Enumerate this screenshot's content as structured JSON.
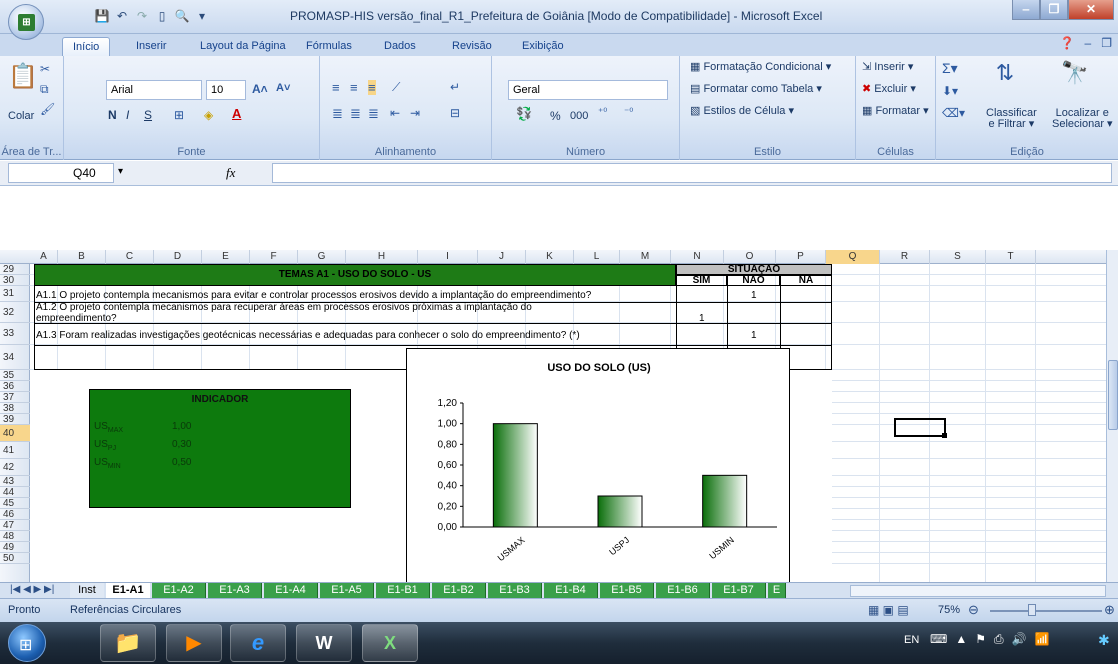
{
  "window": {
    "title": "PROMASP-HIS versão_final_R1_Prefeitura de Goiânia [Modo de Compatibilidade] - Microsoft Excel"
  },
  "ribbon_tabs": [
    "Início",
    "Inserir",
    "Layout da Página",
    "Fórmulas",
    "Dados",
    "Revisão",
    "Exibição"
  ],
  "ribbon": {
    "paste": "Colar",
    "clipboard_label": "Área de Tr...",
    "font_name": "Arial",
    "font_size": "10",
    "bold": "N",
    "italic": "I",
    "underline": "S",
    "font_label": "Fonte",
    "alignment_label": "Alinhamento",
    "number_format": "Geral",
    "percent": "%",
    "thousands": "000",
    "number_label": "Número",
    "cond_format": "Formatação Condicional",
    "format_table": "Formatar como Tabela",
    "cell_styles": "Estilos de Célula",
    "style_label": "Estilo",
    "insert": "Inserir",
    "delete": "Excluir",
    "format": "Formatar",
    "cells_label": "Células",
    "sort_filter_1": "Classificar",
    "sort_filter_2": "e Filtrar",
    "find_select_1": "Localizar e",
    "find_select_2": "Selecionar",
    "editing_label": "Edição"
  },
  "formula_bar": {
    "name_box": "Q40",
    "fx": "fx",
    "formula": ""
  },
  "columns": [
    "A",
    "B",
    "C",
    "D",
    "E",
    "F",
    "G",
    "H",
    "I",
    "J",
    "K",
    "L",
    "M",
    "N",
    "O",
    "P",
    "Q",
    "R",
    "S",
    "T"
  ],
  "rows": [
    "29",
    "30",
    "31",
    "32",
    "33",
    "34",
    "35",
    "36",
    "37",
    "38",
    "39",
    "40",
    "41",
    "42",
    "43",
    "44",
    "45",
    "46",
    "47",
    "48",
    "49",
    "50"
  ],
  "table": {
    "title": "TEMAS A1 - USO DO SOLO - US",
    "situacao": "SITUAÇÃO",
    "sim": "SIM",
    "nao": "NÃO",
    "na": "NA",
    "q1": "A1.1 O projeto contempla mecanismos para evitar e controlar processos erosivos devido a implantação do empreendimento?",
    "q1_nao": "1",
    "q2a": "A1.2 O projeto contempla mecanismos para recuperar áreas em processos erosivos próximas a implantação do",
    "q2b": "empreendimento?",
    "q2_sim": "1",
    "q3": "A1.3 Foram realizadas investigações geotécnicas necessárias e adequadas  para conhecer o solo do empreendimento? (*)",
    "q3_nao": "1"
  },
  "indicator": {
    "title": "INDICADOR",
    "us": "US",
    "max_sub": "MAX",
    "pj_sub": "PJ",
    "min_sub": "MIN",
    "max_val": "1,00",
    "pj_val": "0,30",
    "min_val": "0,50"
  },
  "chart_data": {
    "type": "bar",
    "title": "USO DO SOLO (US)",
    "categories": [
      "USMAX",
      "USPJ",
      "USMIN"
    ],
    "values": [
      1.0,
      0.3,
      0.5
    ],
    "ylim": [
      0,
      1.2
    ],
    "yticks": [
      "0,00",
      "0,20",
      "0,40",
      "0,60",
      "0,80",
      "1,00",
      "1,20"
    ],
    "xlabel": "",
    "ylabel": "",
    "grid": false,
    "bar_fill": "green gradient"
  },
  "sheet_tabs": [
    "Inst",
    "E1-A1",
    "E1-A2",
    "E1-A3",
    "E1-A4",
    "E1-A5",
    "E1-B1",
    "E1-B2",
    "E1-B3",
    "E1-B4",
    "E1-B5",
    "E1-B6",
    "E1-B7",
    "E"
  ],
  "status": {
    "ready": "Pronto",
    "circular": "Referências Circulares",
    "zoom": "75%"
  },
  "taskbar": {
    "lang": "EN"
  },
  "colors": {
    "header_green": "#1e7b16",
    "indicator_green": "#0d7a0d",
    "situacao_gray": "#c0c0c0",
    "tab_green": "#3aa04a"
  }
}
